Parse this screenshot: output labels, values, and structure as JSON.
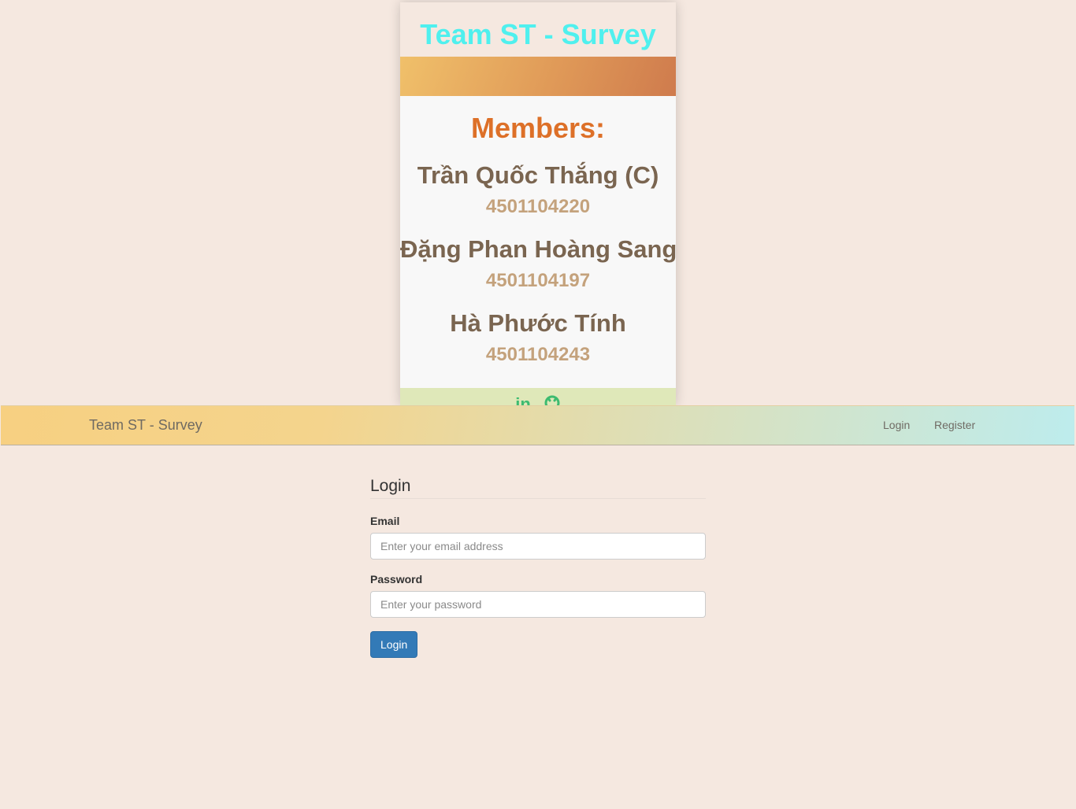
{
  "card": {
    "title": "Team ST - Survey",
    "members_heading": "Members:",
    "members": [
      {
        "name": "Trần Quốc Thắng (C)",
        "id": "4501104220"
      },
      {
        "name": "Đặng Phan Hoàng Sang",
        "id": "4501104197"
      },
      {
        "name": "Hà Phước Tính",
        "id": "4501104243"
      }
    ],
    "footer_icons": [
      "linkedin-icon",
      "github-icon"
    ],
    "linkedin_glyph": "in"
  },
  "navbar": {
    "brand": "Team ST - Survey",
    "links": [
      "Login",
      "Register"
    ]
  },
  "login": {
    "title": "Login",
    "email_label": "Email",
    "email_placeholder": "Enter your email address",
    "password_label": "Password",
    "password_placeholder": "Enter your password",
    "submit_label": "Login"
  },
  "colors": {
    "page_background": "#f5e8e0",
    "card_title": "#4ff0ee",
    "members_heading": "#dd7028",
    "member_name": "#7a6550",
    "member_id": "#c4a27c",
    "button_primary": "#337ab7"
  }
}
